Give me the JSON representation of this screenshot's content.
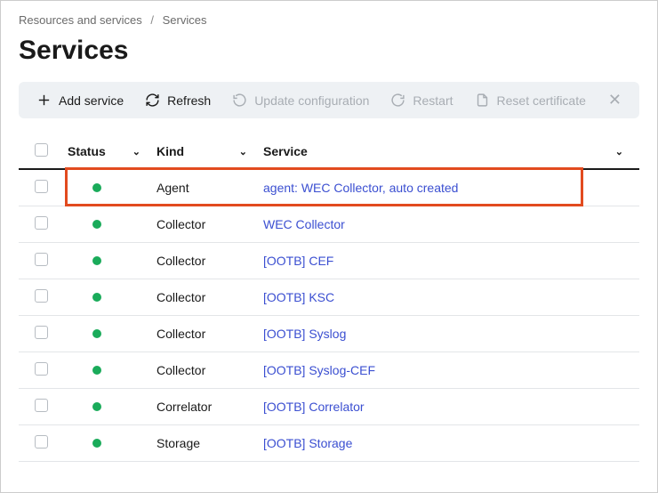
{
  "breadcrumb": {
    "root": "Resources and services",
    "current": "Services"
  },
  "page_title": "Services",
  "toolbar": {
    "add": "Add service",
    "refresh": "Refresh",
    "update_config": "Update configuration",
    "restart": "Restart",
    "reset_cert": "Reset certificate"
  },
  "columns": {
    "status": "Status",
    "kind": "Kind",
    "service": "Service"
  },
  "status_color": "#1aab5a",
  "rows": [
    {
      "status": "green",
      "kind": "Agent",
      "service": "agent: WEC Collector, auto created",
      "highlighted": true
    },
    {
      "status": "green",
      "kind": "Collector",
      "service": "WEC Collector"
    },
    {
      "status": "green",
      "kind": "Collector",
      "service": "[OOTB] CEF"
    },
    {
      "status": "green",
      "kind": "Collector",
      "service": "[OOTB] KSC"
    },
    {
      "status": "green",
      "kind": "Collector",
      "service": "[OOTB] Syslog"
    },
    {
      "status": "green",
      "kind": "Collector",
      "service": "[OOTB] Syslog-CEF"
    },
    {
      "status": "green",
      "kind": "Correlator",
      "service": "[OOTB] Correlator"
    },
    {
      "status": "green",
      "kind": "Storage",
      "service": "[OOTB] Storage"
    }
  ]
}
